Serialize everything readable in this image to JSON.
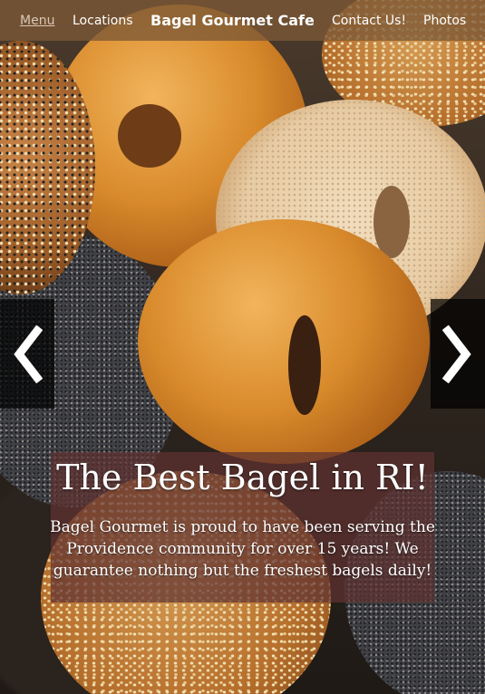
{
  "nav": {
    "items": [
      {
        "label": "Menu",
        "active": true
      },
      {
        "label": "Locations"
      },
      {
        "label": "Contact Us!"
      },
      {
        "label": "Photos"
      }
    ],
    "brand": "Bagel Gourmet Cafe"
  },
  "carousel": {
    "prev_icon": "chevron-left-icon",
    "next_icon": "chevron-right-icon",
    "caption_title": "The Best Bagel in RI!",
    "caption_text": "Bagel Gourmet is proud to have been serving the Providence community for over 15 years! We guarantee nothing but the freshest bagels daily!"
  },
  "colors": {
    "nav_bg": "#7c5836",
    "caption_bg": "#5f3230",
    "arrow_bg": "#000000"
  }
}
